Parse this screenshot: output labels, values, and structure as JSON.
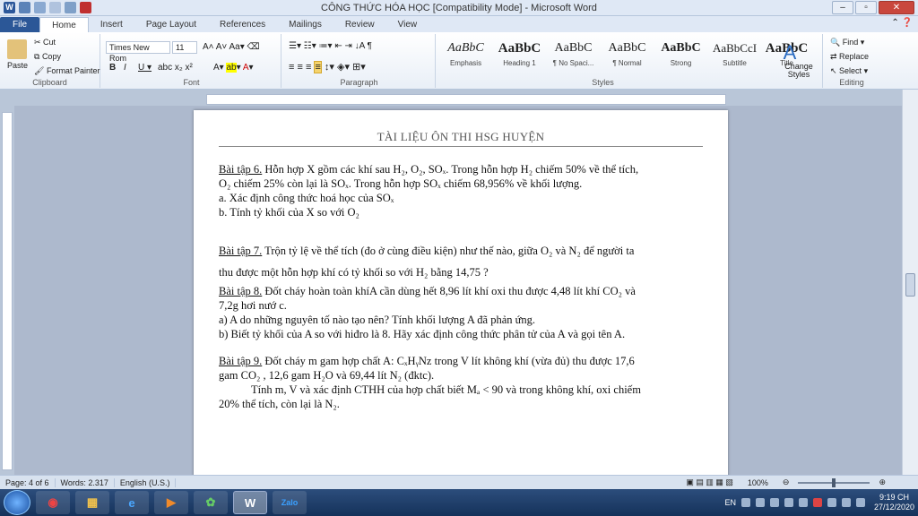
{
  "window": {
    "title": "CÔNG THỨC HÓA HỌC [Compatibility Mode] - Microsoft Word"
  },
  "tabs": [
    "File",
    "Home",
    "Insert",
    "Page Layout",
    "References",
    "Mailings",
    "Review",
    "View"
  ],
  "ribbon": {
    "clipboard": {
      "label": "Clipboard",
      "paste": "Paste",
      "cut": "Cut",
      "copy": "Copy",
      "format_painter": "Format Painter"
    },
    "font": {
      "label": "Font",
      "name": "Times New Rom",
      "size": "11"
    },
    "paragraph": {
      "label": "Paragraph"
    },
    "styles": {
      "label": "Styles",
      "items": [
        {
          "preview": "AaBbC",
          "name": "Emphasis"
        },
        {
          "preview": "AaBbC",
          "name": "Heading 1"
        },
        {
          "preview": "AaBbC",
          "name": "¶ No Spaci..."
        },
        {
          "preview": "AaBbC",
          "name": "¶ Normal"
        },
        {
          "preview": "AaBbC",
          "name": "Strong"
        },
        {
          "preview": "AaBbCcI",
          "name": "Subtitle"
        },
        {
          "preview": "AaBbC",
          "name": "Title"
        }
      ],
      "change_styles": "Change Styles"
    },
    "editing": {
      "label": "Editing",
      "find": "Find",
      "replace": "Replace",
      "select": "Select"
    }
  },
  "document": {
    "header": "TÀI LIỆU ÔN THI HSG HUYỆN",
    "ex6": {
      "label": "Bài tập 6.",
      "l1": " Hỗn hợp X gồm các khí sau H₂, O₂, SOₓ. Trong hỗn hợp H₂ chiếm 50% về thể tích,",
      "l2": "O₂ chiếm 25% còn lại là SOₓ. Trong hỗn hợp SOₓ chiếm 68,956% về khối lượng.",
      "a": " a. Xác định công thức hoá học của SOₓ",
      "b": " b. Tính tỷ khối của X so với O₂"
    },
    "ex7": {
      "label": "Bài tập 7.",
      "l1": " Trộn tỷ lệ về thể tích (đo ở cùng điều kiện) như thế nào, giữa O₂ và N₂ để người ta",
      "l2": "thu được một  hỗn hợp khí có tỷ khối so với H₂ bằng 14,75 ?"
    },
    "ex8": {
      "label": "Bài tập 8.",
      "l1": " Đốt cháy hoàn toàn khíA cần dùng hết 8,96 lít khí oxi thu được 4,48 lít  khí CO₂ và",
      "l2": "7,2g hơi nướ  c.",
      "a": "a) A do những nguyên tố nào tạo nên? Tính  khối lượng A đã phản ứng.",
      "b": "b) Biết tỷ khối của A so với hiđro là 8. Hãy xác định công thức phân tử của A và gọi tên A."
    },
    "ex9": {
      "label": "Bài tập 9.",
      "l1": " Đốt cháy m gam hợp chất A: CₓHᵧNz  trong V lít không khí (vừa đủ) thu được 17,6",
      "l2": "gam CO₂ , 12,6 gam H₂O và 69,44 lít N₂ (đktc).",
      "l3": "Tính m, V và xác định CTHH của hợp chất biết  Mₐ < 90 và trong không khí, oxi chiếm",
      "l4": "20% thể tích, còn lại là N₂."
    }
  },
  "status": {
    "page": "Page: 4 of 6",
    "words": "Words: 2.317",
    "language": "English (U.S.)",
    "zoom": "100%"
  },
  "taskbar": {
    "lang": "EN",
    "time": "9:19 CH",
    "date": "27/12/2020",
    "apps": [
      "start",
      "chrome",
      "explorer",
      "ie",
      "media",
      "app1",
      "word",
      "zalo"
    ]
  }
}
